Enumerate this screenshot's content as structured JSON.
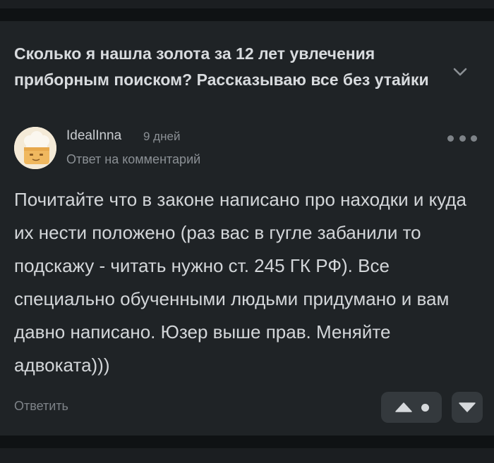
{
  "post": {
    "title": "Сколько я нашла золота за 12 лет увлечения приборным поиском? Рассказываю все без утайки"
  },
  "comment": {
    "author": "IdealInna",
    "time": "9 дней",
    "reply_to": "Ответ на комментарий",
    "text": "Почитайте что в законе написано про находки и куда их нести положено (раз вас в гугле забанили то подскажу - читать нужно ст. 245 ГК РФ). Все специально обученными людьми придумано и вам давно написано. Юзер выше прав. Меняйте адвоката)))",
    "reply_label": "Ответить"
  },
  "icons": {
    "expand": "chevron-down-icon",
    "more": "more-dots-icon",
    "upvote": "triangle-up-icon",
    "downvote": "triangle-down-icon",
    "avatar": "chef-avatar-icon"
  },
  "colors": {
    "background": "#0f1214",
    "card": "#1f2326",
    "text": "#d3d6d9",
    "muted": "#8b9095",
    "button": "#34393d"
  }
}
